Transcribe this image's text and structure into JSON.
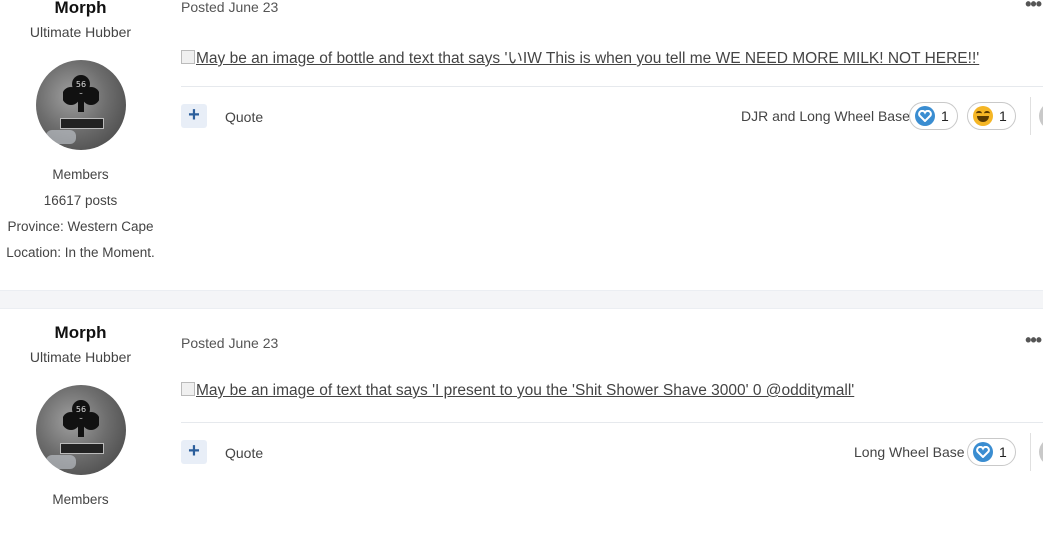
{
  "posts": [
    {
      "author": {
        "name": "Morph",
        "rank": "Ultimate Hubber",
        "group": "Members",
        "posts": "16617 posts",
        "province": "Province: Western Cape",
        "location": "Location: In the Moment."
      },
      "posted": "Posted June 23",
      "image_alt": "May be an image of bottle and text that says 'いIW This is when you tell me WE NEED MORE MILK! NOT HERE!!'",
      "quote_label": "Quote",
      "reacted_by": "DJR and Long Wheel Base",
      "reactions": [
        {
          "icon": "heart-icon",
          "count": "1"
        },
        {
          "icon": "haha-icon",
          "count": "1"
        }
      ]
    },
    {
      "author": {
        "name": "Morph",
        "rank": "Ultimate Hubber",
        "group": "Members"
      },
      "posted": "Posted June 23",
      "image_alt": "May be an image of text that says 'I present to you the 'Shit Shower Shave 3000' 0 @odditymall'",
      "quote_label": "Quote",
      "reacted_by": "Long Wheel Base",
      "reactions": [
        {
          "icon": "heart-icon",
          "count": "1"
        }
      ]
    }
  ],
  "colors": {
    "accent": "#2b5e9b",
    "heart": "#3a8dd1",
    "haha": "#f5b625",
    "separator": "#f4f5f7"
  }
}
